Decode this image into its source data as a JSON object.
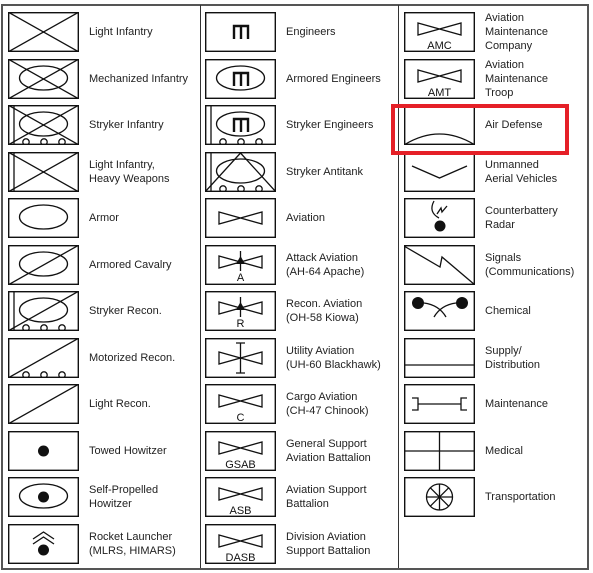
{
  "highlight_color": "#e52027",
  "highlighted_item": "Air Defense",
  "columns": [
    {
      "items": [
        {
          "label": [
            "Light Infantry"
          ],
          "icon": "infantry"
        },
        {
          "label": [
            "Mechanized Infantry"
          ],
          "icon": "mechanized-infantry"
        },
        {
          "label": [
            "Stryker Infantry"
          ],
          "icon": "stryker-infantry"
        },
        {
          "label": [
            "Light Infantry,",
            "Heavy Weapons"
          ],
          "icon": "light-infantry-heavy-weapons"
        },
        {
          "label": [
            "Armor"
          ],
          "icon": "armor"
        },
        {
          "label": [
            "Armored Cavalry"
          ],
          "icon": "armored-cavalry"
        },
        {
          "label": [
            "Stryker Recon."
          ],
          "icon": "stryker-recon"
        },
        {
          "label": [
            "Motorized Recon."
          ],
          "icon": "motorized-recon"
        },
        {
          "label": [
            "Light Recon."
          ],
          "icon": "light-recon"
        },
        {
          "label": [
            "Towed Howitzer"
          ],
          "icon": "towed-howitzer"
        },
        {
          "label": [
            "Self-Propelled",
            "Howitzer"
          ],
          "icon": "self-propelled-howitzer"
        },
        {
          "label": [
            "Rocket Launcher",
            "(MLRS, HIMARS)"
          ],
          "icon": "rocket-launcher"
        }
      ]
    },
    {
      "items": [
        {
          "label": [
            "Engineers"
          ],
          "icon": "engineers"
        },
        {
          "label": [
            "Armored Engineers"
          ],
          "icon": "armored-engineers"
        },
        {
          "label": [
            "Stryker Engineers"
          ],
          "icon": "stryker-engineers"
        },
        {
          "label": [
            "Stryker Antitank"
          ],
          "icon": "stryker-antitank"
        },
        {
          "label": [
            "Aviation"
          ],
          "icon": "aviation"
        },
        {
          "label": [
            "Attack Aviation",
            "(AH-64 Apache)"
          ],
          "icon": "attack-aviation",
          "symbol_text": "A"
        },
        {
          "label": [
            "Recon. Aviation",
            "(OH-58 Kiowa)"
          ],
          "icon": "recon-aviation",
          "symbol_text": "R"
        },
        {
          "label": [
            "Utility Aviation",
            "(UH-60 Blackhawk)"
          ],
          "icon": "utility-aviation"
        },
        {
          "label": [
            "Cargo Aviation",
            "(CH-47 Chinook)"
          ],
          "icon": "cargo-aviation",
          "symbol_text": "C"
        },
        {
          "label": [
            "General Support",
            "Aviation Battalion"
          ],
          "icon": "aviation-text",
          "symbol_text": "GSAB"
        },
        {
          "label": [
            "Aviation Support",
            "Battalion"
          ],
          "icon": "aviation-text",
          "symbol_text": "ASB"
        },
        {
          "label": [
            "Division Aviation",
            "Support Battalion"
          ],
          "icon": "aviation-text",
          "symbol_text": "DASB"
        }
      ]
    },
    {
      "items": [
        {
          "label": [
            "Aviation",
            "Maintenance",
            "Company"
          ],
          "icon": "aviation-text",
          "symbol_text": "AMC"
        },
        {
          "label": [
            "Aviation",
            "Maintenance",
            "Troop"
          ],
          "icon": "aviation-text",
          "symbol_text": "AMT"
        },
        {
          "label": [
            "Air Defense"
          ],
          "icon": "air-defense"
        },
        {
          "label": [
            "Unmanned",
            "Aerial Vehicles"
          ],
          "icon": "uav"
        },
        {
          "label": [
            "Counterbattery",
            "Radar"
          ],
          "icon": "counterbattery-radar"
        },
        {
          "label": [
            "Signals",
            "(Communications)"
          ],
          "icon": "signals"
        },
        {
          "label": [
            "Chemical"
          ],
          "icon": "chemical"
        },
        {
          "label": [
            "Supply/",
            "Distribution"
          ],
          "icon": "supply"
        },
        {
          "label": [
            "Maintenance"
          ],
          "icon": "maintenance"
        },
        {
          "label": [
            "Medical"
          ],
          "icon": "medical"
        },
        {
          "label": [
            "Transportation"
          ],
          "icon": "transportation"
        }
      ]
    }
  ]
}
